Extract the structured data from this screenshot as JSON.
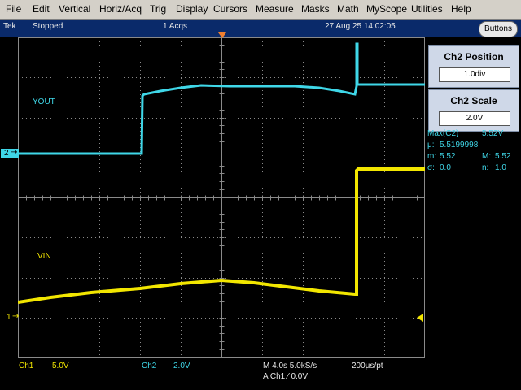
{
  "menu": [
    "File",
    "Edit",
    "Vertical",
    "Horiz/Acq",
    "Trig",
    "Display",
    "Cursors",
    "Measure",
    "Masks",
    "Math",
    "MyScope",
    "Utilities",
    "Help"
  ],
  "status": {
    "brand": "Tek",
    "run_state": "Stopped",
    "acqs": "1 Acqs",
    "datetime": "27 Aug 25 14:02:05",
    "buttons_label": "Buttons"
  },
  "panel": {
    "position_title": "Ch2 Position",
    "position_value": "1.0div",
    "scale_title": "Ch2 Scale",
    "scale_value": "2.0V"
  },
  "measurements": {
    "max_label": "Max(C2)",
    "max_value": "5.52V",
    "mu_label": "μ:",
    "mu_value": "5.5199998",
    "m_label": "m:",
    "m_value": "5.52",
    "M_label": "M:",
    "M_value": "5.52",
    "sigma_label": "σ:",
    "sigma_value": "0.0",
    "n_label": "n:",
    "n_value": "1.0"
  },
  "waveform_labels": {
    "ch2": "YOUT",
    "ch1": "VIN",
    "ch2_marker": "2",
    "ch1_marker": "1"
  },
  "readout": {
    "ch1_name": "Ch1",
    "ch1_scale": "5.0V",
    "ch2_name": "Ch2",
    "ch2_scale": "2.0V",
    "timebase": "M 4.0s 5.0kS/s",
    "trigger": "A  Ch1  ⁄  0.0V",
    "resolution": "200μs/pt"
  },
  "colors": {
    "ch1": "#f2e600",
    "ch2": "#3fd7e8",
    "grid": "#8a8a8a",
    "panel": "#cfd8e8"
  }
}
